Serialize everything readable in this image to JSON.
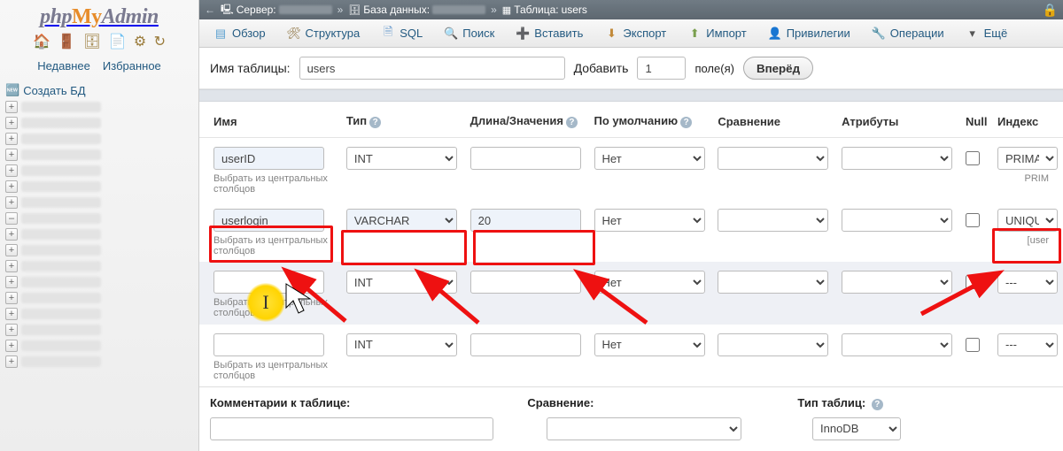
{
  "logo": {
    "p1": "php",
    "p2": "My",
    "p3": "Admin"
  },
  "sidebar": {
    "recent": "Недавнее",
    "favorites": "Избранное",
    "create_db": "Создать БД"
  },
  "breadcrumb": {
    "server_label": "Сервер:",
    "db_label": "База данных:",
    "table_label": "Таблица:",
    "table_value": "users"
  },
  "tabs": {
    "browse": "Обзор",
    "structure": "Структура",
    "sql": "SQL",
    "search": "Поиск",
    "insert": "Вставить",
    "export": "Экспорт",
    "import": "Импорт",
    "privileges": "Привилегии",
    "operations": "Операции",
    "more": "Ещё"
  },
  "table_form": {
    "name_label": "Имя таблицы:",
    "name_value": "users",
    "add_label": "Добавить",
    "add_value": "1",
    "fields_word": "поле(я)",
    "go": "Вперёд"
  },
  "headers": {
    "name": "Имя",
    "type": "Тип",
    "length": "Длина/Значения",
    "default": "По умолчанию",
    "collation": "Сравнение",
    "attributes": "Атрибуты",
    "null": "Null",
    "index": "Индекс"
  },
  "hint": "Выбрать из центральных столбцов",
  "default_none": "Нет",
  "rows": [
    {
      "name": "userID",
      "type": "INT",
      "len": "",
      "def": "Нет",
      "index": "PRIMARY",
      "index_sub": "PRIM"
    },
    {
      "name": "userlogin",
      "type": "VARCHAR",
      "len": "20",
      "def": "Нет",
      "index": "UNIQUE",
      "index_sub": "[user"
    },
    {
      "name": "",
      "type": "INT",
      "len": "",
      "def": "Нет",
      "index": "---",
      "index_sub": ""
    },
    {
      "name": "",
      "type": "INT",
      "len": "",
      "def": "Нет",
      "index": "---",
      "index_sub": ""
    }
  ],
  "bottom": {
    "comments": "Комментарии к таблице:",
    "collation": "Сравнение:",
    "storage": "Тип таблиц:",
    "storage_value": "InnoDB"
  }
}
